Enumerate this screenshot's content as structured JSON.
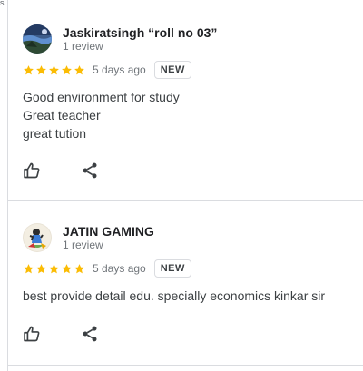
{
  "corner_mark": "s",
  "reviews": [
    {
      "author": "Jaskiratsingh “roll no 03”",
      "review_count": "1 review",
      "stars": 5,
      "age": "5 days ago",
      "badge": "NEW",
      "text_lines": [
        "Good environment for study",
        "Great teacher",
        "great tution"
      ],
      "avatar": "landscape-photo-avatar"
    },
    {
      "author": "JATIN GAMING",
      "review_count": "1 review",
      "stars": 5,
      "age": "5 days ago",
      "badge": "NEW",
      "text_lines": [
        "best provide detail edu. specially economics kinkar sir"
      ],
      "avatar": "gaming-character-avatar"
    }
  ],
  "icons": {
    "star": "star-icon",
    "like": "thumb-up-icon",
    "share": "share-icon"
  },
  "colors": {
    "star": "#fbbc04",
    "divider": "#dadce0",
    "text": "#3c4043",
    "muted": "#70757a"
  }
}
